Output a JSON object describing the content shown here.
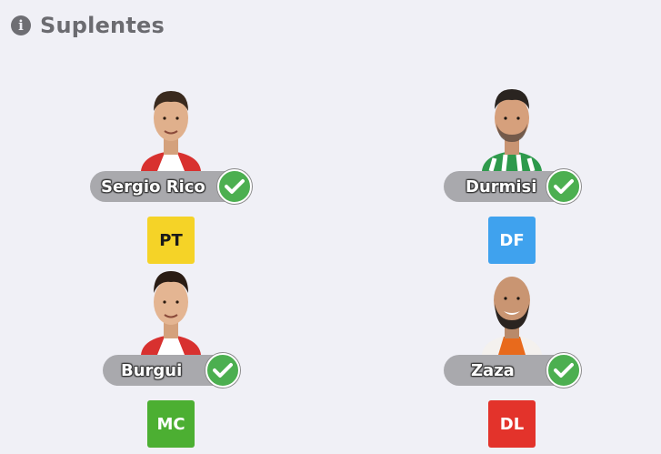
{
  "header": {
    "icon": "info-icon",
    "title": "Suplentes"
  },
  "players": [
    {
      "name": "Sergio Rico",
      "position": "PT",
      "position_color": "#f5d327",
      "position_text_color": "#1a1a1a",
      "shirt_color": "#d8312f",
      "confirmed": true
    },
    {
      "name": "Durmisi",
      "position": "DF",
      "position_color": "#3fa2ee",
      "position_text_color": "#ffffff",
      "shirt_color": "#2e9a4c",
      "confirmed": true
    },
    {
      "name": "Burgui",
      "position": "MC",
      "position_color": "#4caf32",
      "position_text_color": "#ffffff",
      "shirt_color": "#d8312f",
      "confirmed": true
    },
    {
      "name": "Zaza",
      "position": "DL",
      "position_color": "#e3332b",
      "position_text_color": "#ffffff",
      "shirt_color": "#e86a1c",
      "confirmed": true
    }
  ]
}
